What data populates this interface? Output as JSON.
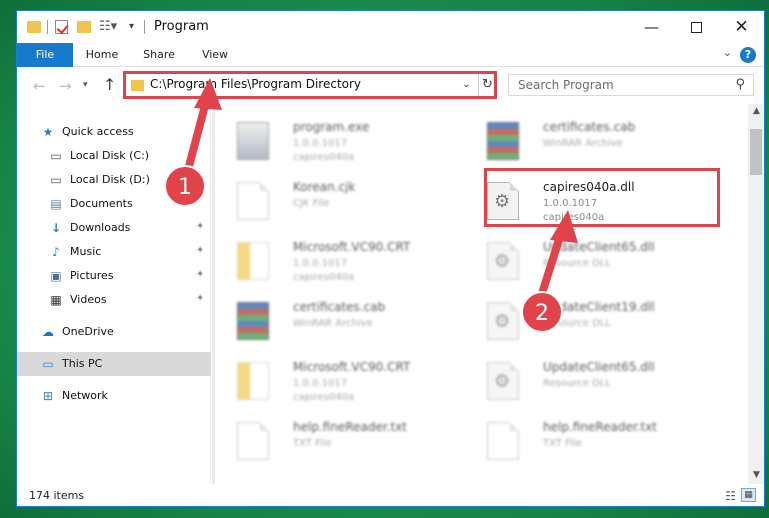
{
  "window": {
    "title": "Program"
  },
  "ribbon": {
    "file": "File",
    "home": "Home",
    "share": "Share",
    "view": "View",
    "help": "?"
  },
  "address": {
    "path": "C:\\Program Files\\Program Directory",
    "search_placeholder": "Search Program"
  },
  "sidebar": {
    "items": [
      {
        "label": "Quick access",
        "icon": "star-icon"
      },
      {
        "label": "Local Disk (C:)",
        "icon": "drive-icon"
      },
      {
        "label": "Local Disk (D:)",
        "icon": "drive-icon"
      },
      {
        "label": "Documents",
        "icon": "documents-icon"
      },
      {
        "label": "Downloads",
        "icon": "download-icon"
      },
      {
        "label": "Music",
        "icon": "music-icon"
      },
      {
        "label": "Pictures",
        "icon": "pictures-icon"
      },
      {
        "label": "Videos",
        "icon": "videos-icon"
      },
      {
        "label": "OneDrive",
        "icon": "cloud-icon"
      },
      {
        "label": "This PC",
        "icon": "computer-icon"
      },
      {
        "label": "Network",
        "icon": "network-icon"
      }
    ]
  },
  "files": [
    {
      "name": "program.exe",
      "line1": "1.0.0.1017",
      "line2": "capires040a",
      "type": "exe"
    },
    {
      "name": "certificates.cab",
      "line1": "WinRAR Archive",
      "line2": "",
      "type": "rar"
    },
    {
      "name": "Korean.cjk",
      "line1": "CJK File",
      "line2": "",
      "type": "doc"
    },
    {
      "name": "capires040a.dll",
      "line1": "1.0.0.1017",
      "line2": "capires040a",
      "type": "dll"
    },
    {
      "name": "Microsoft.VC90.CRT",
      "line1": "1.0.0.1017",
      "line2": "capires040a",
      "type": "folderfile"
    },
    {
      "name": "UpdateClient65.dll",
      "line1": "Resource DLL",
      "line2": "",
      "type": "dll"
    },
    {
      "name": "certificates.cab",
      "line1": "WinRAR Archive",
      "line2": "",
      "type": "rar"
    },
    {
      "name": "UpdateClient19.dll",
      "line1": "Resource DLL",
      "line2": "",
      "type": "dll"
    },
    {
      "name": "Microsoft.VC90.CRT",
      "line1": "1.0.0.1017",
      "line2": "capires040a",
      "type": "folderfile"
    },
    {
      "name": "UpdateClient65.dll",
      "line1": "Resource DLL",
      "line2": "",
      "type": "dll"
    },
    {
      "name": "help.fineReader.txt",
      "line1": "TXT File",
      "line2": "",
      "type": "doc"
    },
    {
      "name": "help.fineReader.txt",
      "line1": "TXT File",
      "line2": "",
      "type": "doc"
    }
  ],
  "status": {
    "count": "174 items"
  },
  "annotations": {
    "step1": "1",
    "step2": "2",
    "color": "#e0434a"
  }
}
